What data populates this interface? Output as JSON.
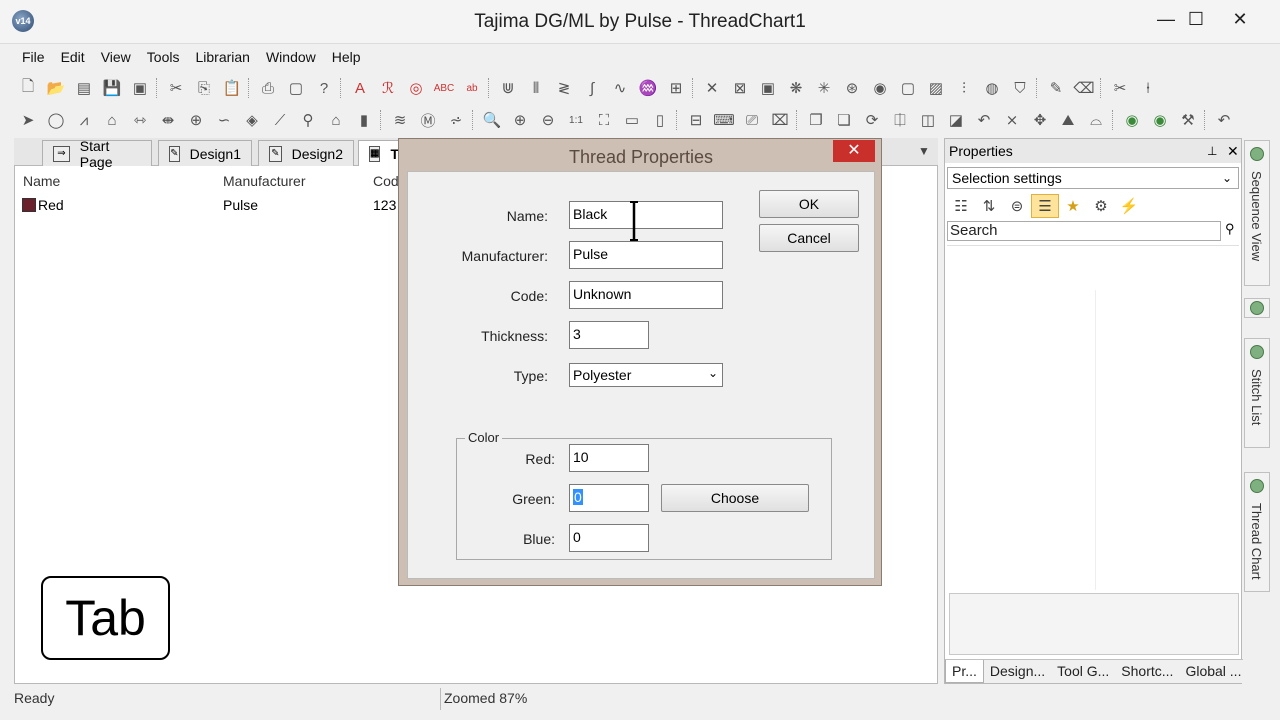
{
  "window": {
    "title": "Tajima DG/ML by Pulse - ThreadChart1",
    "app_icon_label": "v14",
    "minimize": "—",
    "maximize": "☐",
    "close": "✕"
  },
  "menu": [
    "File",
    "Edit",
    "View",
    "Tools",
    "Librarian",
    "Window",
    "Help"
  ],
  "doc_tabs": {
    "start": "Start Page",
    "design1": "Design1",
    "design2": "Design2",
    "thread": "Th"
  },
  "thread_table": {
    "headers": [
      "Name",
      "Manufacturer",
      "Cod"
    ],
    "rows": [
      {
        "name": "Red",
        "manufacturer": "Pulse",
        "code": "123",
        "swatch_color": "#6a1f2a"
      }
    ]
  },
  "tab_key_label": "Tab",
  "dialog": {
    "title": "Thread Properties",
    "close": "✕",
    "ok": "OK",
    "cancel": "Cancel",
    "name_label": "Name:",
    "name_value": "Black",
    "manufacturer_label": "Manufacturer:",
    "manufacturer_value": "Pulse",
    "code_label": "Code:",
    "code_value": "Unknown",
    "thickness_label": "Thickness:",
    "thickness_value": "3",
    "type_label": "Type:",
    "type_value": "Polyester",
    "color_group_label": "Color",
    "red_label": "Red:",
    "red_value": "10",
    "green_label": "Green:",
    "green_value": "0",
    "blue_label": "Blue:",
    "blue_value": "0",
    "choose": "Choose"
  },
  "properties": {
    "header": "Properties",
    "pin": "⊥",
    "close": "✕",
    "selection": "Selection settings",
    "search_placeholder": "Search",
    "bottom_tabs": [
      "Pr...",
      "Design...",
      "Tool G...",
      "Shortc...",
      "Global ..."
    ]
  },
  "side_tabs": [
    "Sequence View",
    "Stitch List",
    "Thread Chart"
  ],
  "status": {
    "left": "Ready",
    "zoom": "Zoomed 87%"
  }
}
